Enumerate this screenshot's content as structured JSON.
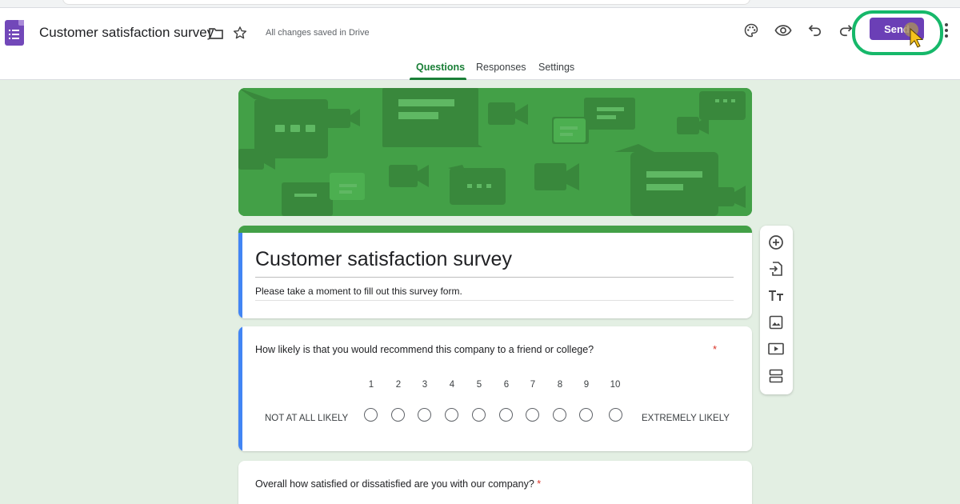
{
  "app": {
    "title": "Customer satisfaction survey",
    "save_status": "All changes saved in Drive",
    "send_label": "Send"
  },
  "header_icons": [
    "forms-logo-icon",
    "folder-icon",
    "star-icon",
    "palette-icon",
    "preview-eye-icon",
    "undo-icon",
    "redo-icon",
    "more-vert-icon"
  ],
  "tabs": [
    {
      "label": "Questions",
      "active": true
    },
    {
      "label": "Responses",
      "active": false
    },
    {
      "label": "Settings",
      "active": false
    }
  ],
  "form": {
    "title": "Customer satisfaction survey",
    "description": "Please take a moment to fill out this survey form."
  },
  "questions": [
    {
      "text": "How likely is that you would recommend this company to a friend or college?",
      "required": true,
      "required_mark": "*",
      "type": "linear-scale",
      "scale_labels": [
        "1",
        "2",
        "3",
        "4",
        "5",
        "6",
        "7",
        "8",
        "9",
        "10"
      ],
      "low_label": "NOT AT ALL LIKELY",
      "high_label": "EXTREMELY LIKELY"
    },
    {
      "text": "Overall how satisfied or dissatisfied are you with our company?",
      "required": true,
      "required_mark": "*"
    }
  ],
  "side_toolbar": [
    "add-question-icon",
    "import-questions-icon",
    "add-title-icon",
    "add-image-icon",
    "add-video-icon",
    "add-section-icon"
  ],
  "colors": {
    "accent_purple": "#6b3fb6",
    "theme_green": "#43a047",
    "highlight_ring": "#16b86a",
    "focus_blue": "#4285f4",
    "page_background": "#e3efe3",
    "required_red": "#d93025"
  }
}
